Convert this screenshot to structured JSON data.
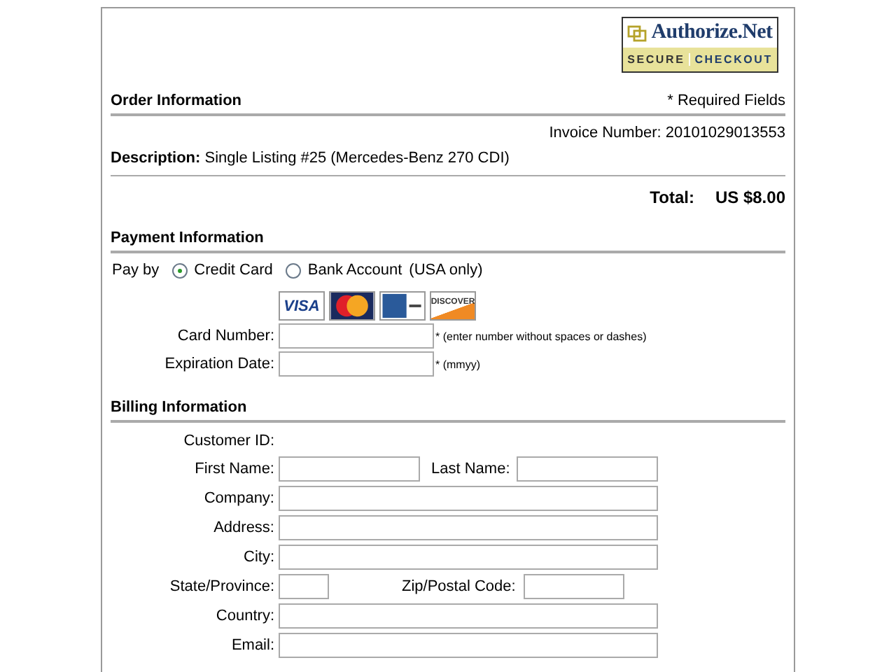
{
  "logo": {
    "brand": "Authorize.Net",
    "tagline_left": "SECURE",
    "tagline_right": "CHECKOUT"
  },
  "order": {
    "heading": "Order Information",
    "required_note": "* Required Fields",
    "invoice": "Invoice Number: 20101029013553",
    "description_label": "Description:",
    "description": "Single Listing #25 (Mercedes-Benz 270 CDI)",
    "total_label": "Total:",
    "total": "US $8.00"
  },
  "payment": {
    "heading": "Payment Information",
    "pay_by": "Pay by",
    "methods": [
      {
        "label": "Credit Card",
        "selected": true
      },
      {
        "label": "Bank Account",
        "note": "(USA only)",
        "selected": false
      }
    ],
    "card_logos": [
      {
        "kind": "visa",
        "label": "VISA"
      },
      {
        "kind": "mastercard"
      },
      {
        "kind": "amex"
      },
      {
        "kind": "discover",
        "label": "DISCOVER"
      }
    ],
    "fields": [
      {
        "label": "Card Number:",
        "hint": "* (enter number without spaces or dashes)"
      },
      {
        "label": "Expiration Date:",
        "hint": "* (mmyy)"
      }
    ]
  },
  "billing": {
    "heading": "Billing Information",
    "rows": [
      {
        "kind": "text",
        "label": "Customer ID:"
      },
      {
        "kind": "pair",
        "label": "First Name:",
        "label2": "Last Name:"
      },
      {
        "kind": "wide",
        "label": "Company:"
      },
      {
        "kind": "wide",
        "label": "Address:"
      },
      {
        "kind": "wide",
        "label": "City:"
      },
      {
        "kind": "pair_small",
        "label": "State/Province:",
        "label2": "Zip/Postal Code:"
      },
      {
        "kind": "wide",
        "label": "Country:"
      },
      {
        "kind": "wide",
        "label": "Email:"
      }
    ]
  }
}
